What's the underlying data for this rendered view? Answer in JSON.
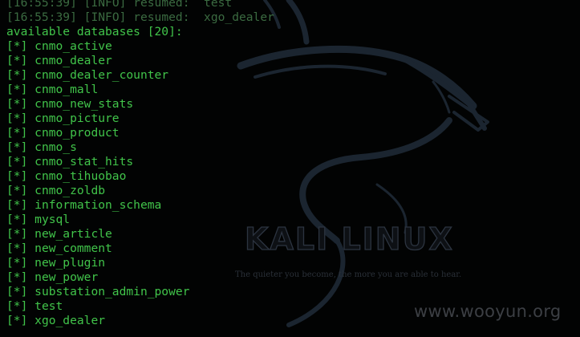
{
  "colors": {
    "terminal_text": "#41c44a",
    "log_text": "#3b6b41",
    "background": "#020303",
    "dragon": "#1b2530"
  },
  "wallpaper": {
    "title": "KALI LINUX",
    "tagline": "The quieter you become, the more you are able to hear.",
    "icon": "kali-dragon-icon"
  },
  "watermark": "www.wooyun.org",
  "terminal": {
    "log_lines": [
      {
        "time": "[16:55:39]",
        "level": "[INFO]",
        "message": "resumed:  test"
      },
      {
        "time": "[16:55:39]",
        "level": "[INFO]",
        "message": "resumed:  xgo_dealer"
      }
    ],
    "header": "available databases [20]:",
    "marker": "[*]",
    "databases": [
      "cnmo_active",
      "cnmo_dealer",
      "cnmo_dealer_counter",
      "cnmo_mall",
      "cnmo_new_stats",
      "cnmo_picture",
      "cnmo_product",
      "cnmo_s",
      "cnmo_stat_hits",
      "cnmo_tihuobao",
      "cnmo_zoldb",
      "information_schema",
      "mysql",
      "new_article",
      "new_comment",
      "new_plugin",
      "new_power",
      "substation_admin_power",
      "test",
      "xgo_dealer"
    ]
  }
}
